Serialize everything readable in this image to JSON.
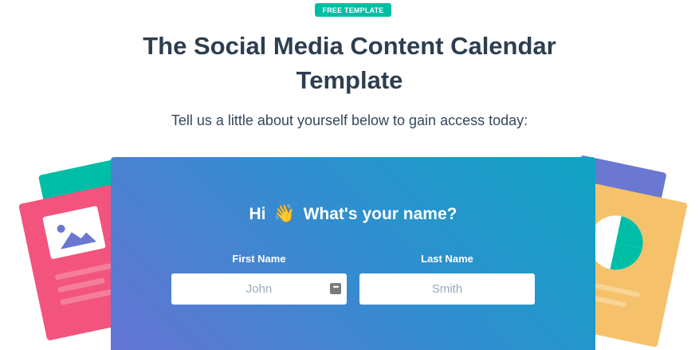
{
  "badge": {
    "label": "FREE TEMPLATE"
  },
  "heading": {
    "title_line1": "The Social Media Content Calendar",
    "title_line2": "Template",
    "subtitle": "Tell us a little about yourself below to gain access today:"
  },
  "form": {
    "greeting_before": "Hi",
    "greeting_emoji": "👋",
    "greeting_after": "What's your name?",
    "first_name": {
      "label": "First Name",
      "placeholder": "John",
      "value": ""
    },
    "last_name": {
      "label": "Last Name",
      "placeholder": "Smith",
      "value": ""
    }
  },
  "colors": {
    "badge": "#00bda5",
    "title": "#2d3e50",
    "panel_start": "#0fa4c4",
    "panel_end": "#6474d2",
    "card_pink": "#f2547d",
    "card_teal": "#00bda5",
    "card_purple": "#6a78d1",
    "card_orange": "#f5c26b"
  }
}
